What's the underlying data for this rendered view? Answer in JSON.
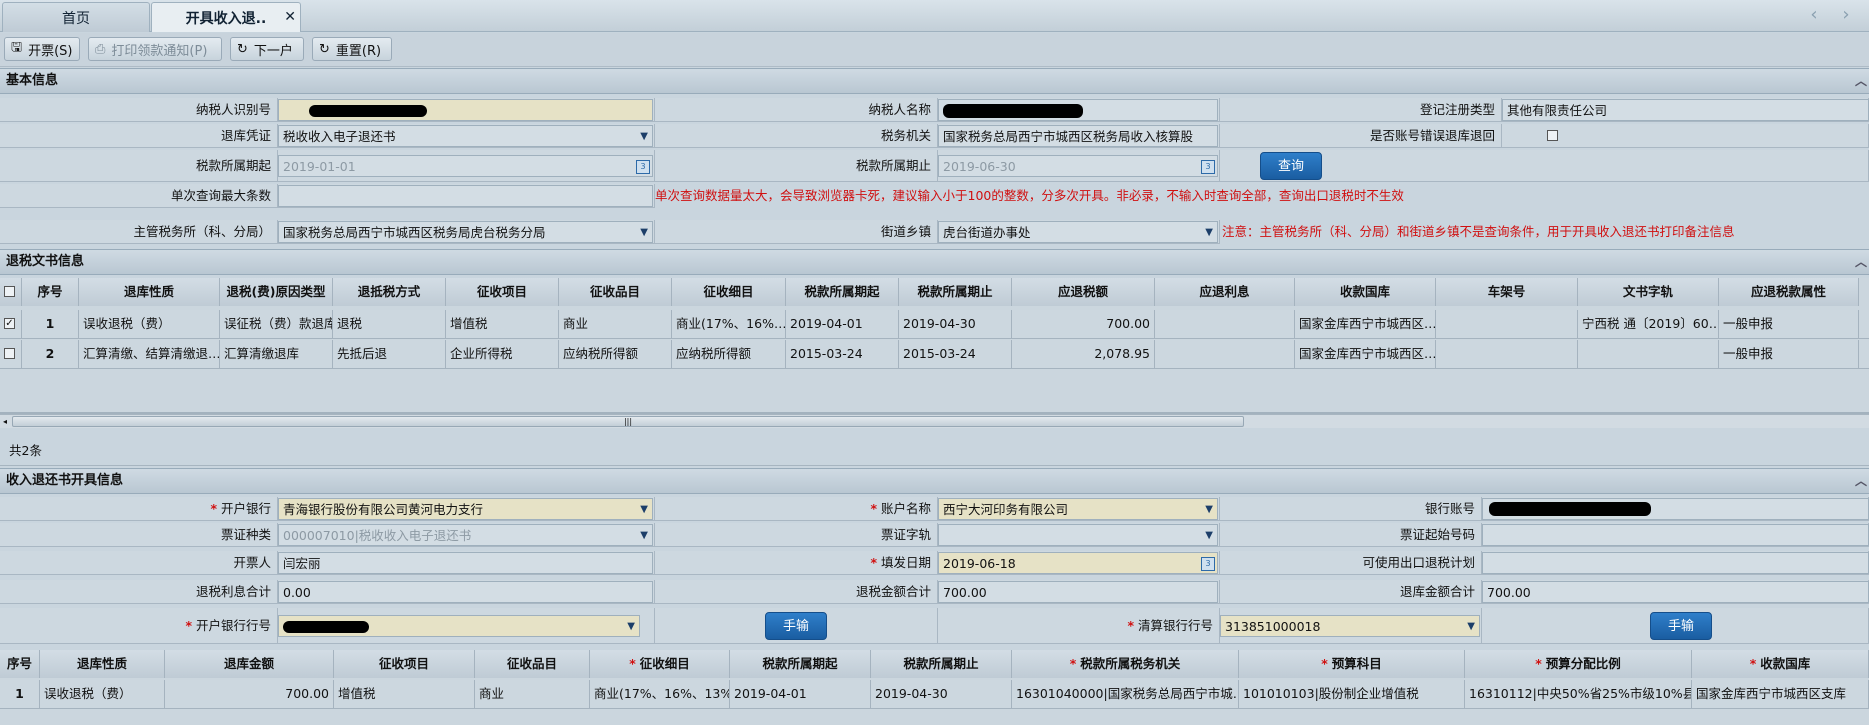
{
  "tabs": {
    "home": "首页",
    "active": "开具收入退..",
    "close": "✕"
  },
  "nav": {
    "prev": "‹",
    "next": "›"
  },
  "toolbar": {
    "open": "开票(S)",
    "print": "打印领款通知(P)",
    "next": "下一户",
    "reset": "重置(R)"
  },
  "basic": {
    "section_title": "基本信息",
    "taxpayer_id_label": "纳税人识别号",
    "taxpayer_name_label": "纳税人名称",
    "reg_type_label": "登记注册类型",
    "reg_type_value": "其他有限责任公司",
    "voucher_label": "退库凭证",
    "voucher_value": "税收收入电子退还书",
    "tax_office_label": "税务机关",
    "tax_office_value": "国家税务总局西宁市城西区税务局收入核算股",
    "wrong_return_label": "是否账号错误退库退回",
    "period_start_label": "税款所属期起",
    "period_start_value": "2019-01-01",
    "period_end_label": "税款所属期止",
    "period_end_value": "2019-06-30",
    "query_button": "查询",
    "max_rows_label": "单次查询最大条数",
    "max_rows_hint": "单次查询数据量太大，会导致浏览器卡死，建议输入小于100的整数，分多次开具。非必录，不输入时查询全部，查询出口退税时不生效",
    "office_label": "主管税务所（科、分局）",
    "office_value": "国家税务总局西宁市城西区税务局虎台税务分局",
    "street_label": "街道乡镇",
    "street_value": "虎台街道办事处",
    "street_note": "注意：主管税务所（科、分局）和街道乡镇不是查询条件，用于开具收入退还书打印备注信息"
  },
  "docs": {
    "section_title": "退税文书信息",
    "headers": [
      "序号",
      "退库性质",
      "退税(费)原因类型",
      "退抵税方式",
      "征收项目",
      "征收品目",
      "征收细目",
      "税款所属期起",
      "税款所属期止",
      "应退税额",
      "应退利息",
      "收款国库",
      "车架号",
      "文书字轨",
      "应退税款属性"
    ],
    "rows": [
      {
        "checked": "✓",
        "cells": [
          "1",
          "误收退税（费）",
          "误征税（费）款退库",
          "退税",
          "增值税",
          "商业",
          "商业(17%、16%…",
          "2019-04-01",
          "2019-04-30",
          "700.00",
          "",
          "国家金库西宁市城西区…",
          "",
          "宁西税 通〔2019〕60…",
          "一般申报"
        ]
      },
      {
        "checked": "",
        "cells": [
          "2",
          "汇算清缴、结算清缴退…",
          "汇算清缴退库",
          "先抵后退",
          "企业所得税",
          "应纳税所得额",
          "应纳税所得额",
          "2015-03-24",
          "2015-03-24",
          "2,078.95",
          "",
          "国家金库西宁市城西区…",
          "",
          "",
          "一般申报"
        ]
      }
    ],
    "total": "共2条"
  },
  "refund": {
    "section_title": "收入退还书开具信息",
    "bank_label": "开户银行",
    "bank_value": "青海银行股份有限公司黄河电力支行",
    "account_name_label": "账户名称",
    "account_name_value": "西宁大河印务有限公司",
    "account_no_label": "银行账号",
    "ticket_type_label": "票证种类",
    "ticket_type_value": "000007010|税收收入电子退还书",
    "ticket_track_label": "票证字轨",
    "ticket_start_label": "票证起始号码",
    "issuer_label": "开票人",
    "issuer_value": "闫宏丽",
    "fill_date_label": "填发日期",
    "fill_date_value": "2019-06-18",
    "export_plan_label": "可使用出口退税计划",
    "interest_total_label": "退税利息合计",
    "interest_total_value": "0.00",
    "refund_total_label": "退税金额合计",
    "refund_total_value": "700.00",
    "return_total_label": "退库金额合计",
    "return_total_value": "700.00",
    "bank_code_label": "开户银行行号",
    "manual_button": "手输",
    "clear_bank_label": "清算银行行号",
    "clear_bank_value": "313851000018",
    "manual_button2": "手输"
  },
  "detail": {
    "headers": [
      "序号",
      "退库性质",
      "退库金额",
      "征收项目",
      "征收品目",
      "征收细目",
      "税款所属期起",
      "税款所属期止",
      "税款所属税务机关",
      "预算科目",
      "预算分配比例",
      "收款国库"
    ],
    "row": [
      "1",
      "误收退税（费）",
      "700.00",
      "增值税",
      "商业",
      "商业(17%、16%、13%)",
      "2019-04-01",
      "2019-04-30",
      "16301040000|国家税务总局西宁市城…",
      "101010103|股份制企业增值税",
      "16310112|中央50%省25%市级10%县…",
      "国家金库西宁市城西区支库"
    ]
  }
}
